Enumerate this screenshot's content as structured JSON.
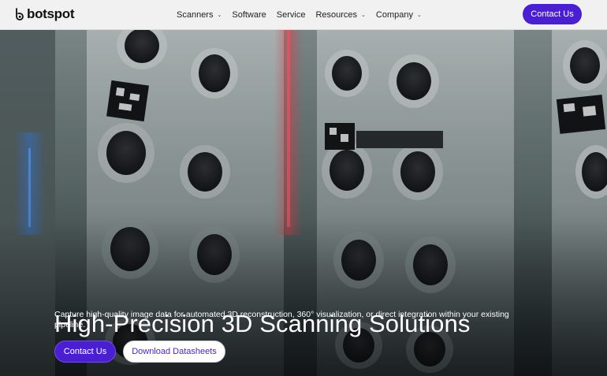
{
  "brand": {
    "name": "botspot"
  },
  "nav": {
    "items": [
      {
        "label": "Scanners",
        "has_dropdown": true
      },
      {
        "label": "Software",
        "has_dropdown": false
      },
      {
        "label": "Service",
        "has_dropdown": false
      },
      {
        "label": "Resources",
        "has_dropdown": true
      },
      {
        "label": "Company",
        "has_dropdown": true
      }
    ],
    "cta_label": "Contact Us"
  },
  "hero": {
    "title": "High-Precision 3D Scanning Solutions",
    "subtitle": "Capture high-quality image data for automated 3D reconstruction, 360° visualization, or direct integration within your existing pipeline.",
    "primary_button": "Contact Us",
    "secondary_button": "Download Datasheets"
  },
  "colors": {
    "accent": "#4a1ed1",
    "nav_bg": "#f1f1f1",
    "hero_overlay": "#1b2426"
  }
}
